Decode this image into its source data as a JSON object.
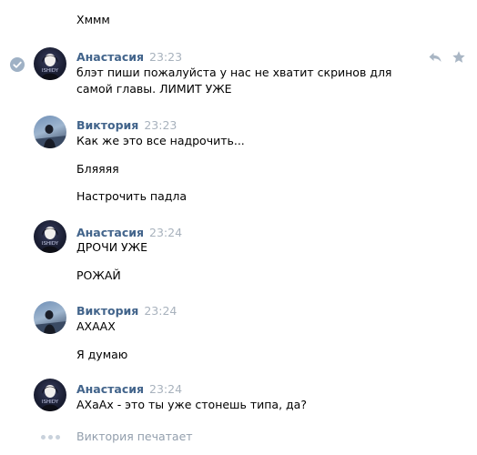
{
  "messages": {
    "intro_text": "Хммм",
    "group1": {
      "author": "Анастасия",
      "time": "23:23",
      "text": "блэт пиши пожалуйста у нас не хватит скринов для самой главы. ЛИМИТ УЖЕ",
      "avatar_text": "ISHIDY"
    },
    "group2": {
      "author": "Виктория",
      "time": "23:23",
      "text1": "Как же это все надрочить...",
      "text2": "Бляяяя",
      "text3": "Настрочить падла"
    },
    "group3": {
      "author": "Анастасия",
      "time": "23:24",
      "text1": "ДРОЧИ УЖЕ",
      "text2": "РОЖАЙ",
      "avatar_text": "ISHIDY"
    },
    "group4": {
      "author": "Виктория",
      "time": "23:24",
      "text1": "АХААХ",
      "text2": "Я думаю"
    },
    "group5": {
      "author": "Анастасия",
      "time": "23:24",
      "text1": "АХаАх - это ты уже стонешь типа, да?",
      "avatar_text": "ISHIDY"
    }
  },
  "typing": {
    "text": "Виктория печатает"
  },
  "icons": {
    "selected": "check-circle-icon",
    "reply": "reply-icon",
    "favorite": "star-icon"
  },
  "colors": {
    "author": "#42648b",
    "time": "#a8b2bd",
    "typing": "#939fad"
  }
}
